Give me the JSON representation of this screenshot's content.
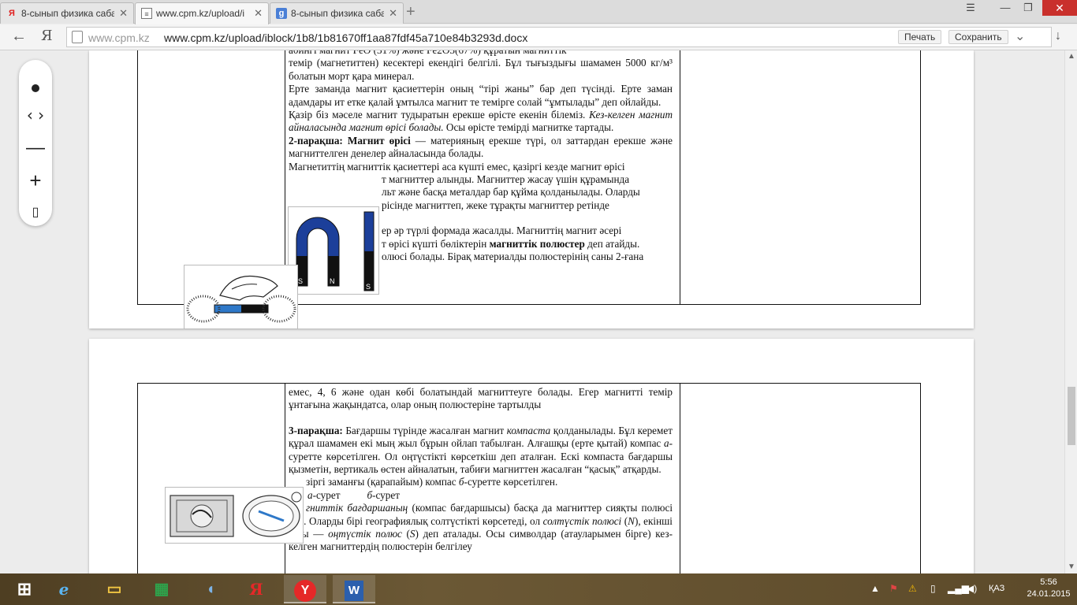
{
  "tabs": [
    {
      "label": "8-сынып физика сабақ",
      "icon": "yandex-icon",
      "active": false
    },
    {
      "label": "www.cpm.kz/upload/i",
      "icon": "page-icon",
      "active": true
    },
    {
      "label": "8-сынып физика сабақ",
      "icon": "google-icon",
      "active": false
    }
  ],
  "address": {
    "domain": "www.cpm.kz",
    "url": "www.cpm.kz/upload/iblock/1b8/1b81670ff1aa87fdf45a710e84b3293d.docx",
    "print_label": "Печать",
    "save_label": "Сохранить",
    "ya_label": "Я"
  },
  "page1": {
    "lines": [
      "а0йнгі магнит FeO (31%) және Fe2O3(67%) құратын магниттік",
      "темір (магнетиттен) кесектері екендігі белгілі. Бұл тығыздығы шамамен 5000 кг/м³ болатын морт қара минерал.",
      "Ерте заманда магнит қасиеттерін оның “тірі жаны” бар деп түсінді. Ерте заман адамдары ит етке қалай ұмтылса магнит те темірге солай “ұмтылады” деп ойлайды."
    ],
    "para_field_before": "Қазір біз мәселе магнит тудыратын ерекше өрісте екенін білеміз. ",
    "para_field_italic": "Кез-келген магнит айналасында магнит өрісі болады.",
    "para_field_after": " Осы өрісте темірді магнитке тартады.",
    "sheet2_label": "2-парақша: Магнит өрісі",
    "sheet2_text": " — материяның ерекше түрі, ол заттардан ерекше және магниттелген денелер айналасында болады.",
    "magnet_lines": [
      "Магнетиттің магниттік қасиеттері аса күшті емес, қазіргі кезде магнит өрісі",
      "т магниттер алынды. Магниттер жасау  үшін құрамында",
      "льт және басқа металдар бар құйма қолданылады. Оларды",
      "рісінде магниттеп, жеке тұрақты магниттер ретінде"
    ],
    "poles_line_a": "ер әр түрлі формада жасалды. Магниттің магнит әсері",
    "poles_line_b": "т өрісі күшті бөліктерін ",
    "poles_bold": "магниттік полюстер",
    "poles_line_c": " деп атайды.",
    "poles_line_d": "олюсі болады. Бірақ материалды полюстерінің саны 2-ғана"
  },
  "page2": {
    "line1": "емес, 4, 6 және одан көбі болатындай магниттеуге болады. Егер магнитті темір ұнтағына жақындатса, олар оның полюстеріне тартылды",
    "sheet3_label": "3-парақша:",
    "sheet3_a": " Бағдаршы түрінде жасалған магнит ",
    "sheet3_italic": "компаста",
    "sheet3_b": " қолданылады. Бұл керемет құрал шамамен екі мың жыл бұрын ойлап табылған. Алғашқы (ерте қытай) компас ",
    "sheet3_ital_a": "а",
    "sheet3_c": "-суретте көрсетілген. Ол оңтүстікті көрсеткіш деп аталған. Ескі компаста бағдаршы қызметін, вертикаль өстен айналатын, табиғи магниттен жасалған “қасық” атқарды.",
    "modern_a": "зіргі заманғы (қарапайым) компас  ",
    "modern_italic": "б",
    "modern_b": "-суретте көрсетілген.",
    "caption_a_letter": "а",
    "caption_a": "-сурет",
    "caption_b_letter": "б",
    "caption_b": "-сурет",
    "needle_italic": "гниттік бағдаршаның",
    "needle_a": " (компас бағдаршысы) басқа да магниттер сияқты",
    "needle_b": " полюсі бар. Оларды бірі географиялық солтүстікті көрсетеді, ол ",
    "north_italic": "солтүстік полюсі",
    "north_open": " (",
    "north_letter": "N",
    "needle_c": "), екінші ұшы — ",
    "south_italic": "оңтүстік полюс",
    "south_open": " (",
    "south_letter": "S",
    "needle_d": ") деп аталады. Осы символдар (атауларымен бірге) кез-келген магниттердің полюстерін белгілеу"
  },
  "magnet_image": {
    "left_letter": "S",
    "right_letter": "N",
    "bar_letter": "S"
  },
  "zoom": {
    "nav_label": "‹ ›",
    "minus_label": "—",
    "plus_label": "+",
    "fit_label": "▯"
  },
  "tray": {
    "lang": "ҚАЗ",
    "time": "5:56",
    "date": "24.01.2015"
  },
  "colors": {
    "accent": "#2b5fad",
    "close": "#c9302c"
  }
}
